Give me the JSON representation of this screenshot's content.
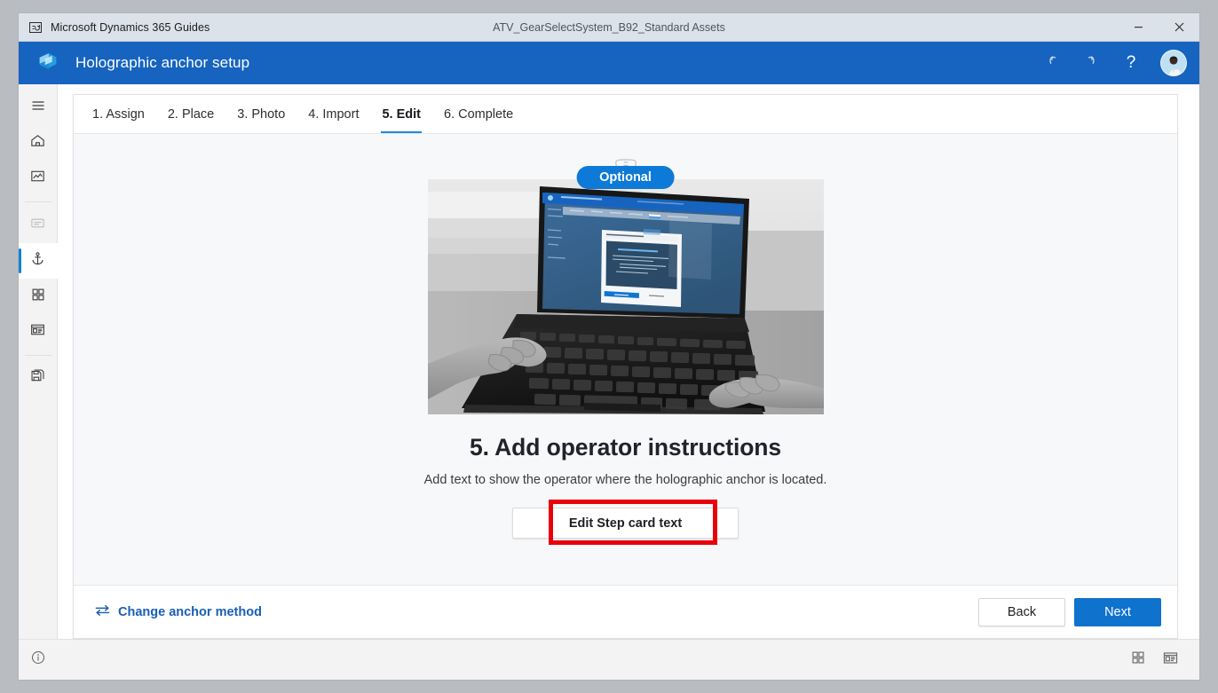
{
  "window": {
    "app_title": "Microsoft Dynamics 365 Guides",
    "document_title": "ATV_GearSelectSystem_B92_Standard Assets",
    "app_icon": "guides-app-icon",
    "controls": {
      "minimize": "minimize-icon",
      "close": "close-icon"
    }
  },
  "header": {
    "logo": "dynamics-guides-logo",
    "title": "Holographic anchor setup",
    "actions": [
      {
        "name": "undo-button",
        "icon": "undo-icon"
      },
      {
        "name": "redo-button",
        "icon": "redo-icon"
      },
      {
        "name": "help-button",
        "icon": "question-mark-icon",
        "label": "?"
      }
    ],
    "avatar": "user-avatar"
  },
  "sidebar": {
    "items": [
      {
        "name": "menu-toggle",
        "icon": "hamburger-menu-icon",
        "state": "default"
      },
      {
        "name": "home",
        "icon": "home-icon",
        "state": "default"
      },
      {
        "name": "analytics",
        "icon": "analytics-image-icon",
        "state": "default"
      },
      {
        "name": "outline",
        "icon": "document-lines-icon",
        "state": "disabled"
      },
      {
        "name": "anchor",
        "icon": "anchor-icon",
        "state": "selected"
      },
      {
        "name": "steps-grid",
        "icon": "grid-squares-icon",
        "state": "default"
      },
      {
        "name": "step-card",
        "icon": "step-card-icon",
        "state": "default"
      },
      {
        "name": "assets",
        "icon": "save-copy-icon",
        "state": "default"
      }
    ],
    "bottom": {
      "name": "info",
      "icon": "info-circle-icon"
    }
  },
  "tabs": [
    {
      "label": "1. Assign",
      "active": false
    },
    {
      "label": "2. Place",
      "active": false
    },
    {
      "label": "3. Photo",
      "active": false
    },
    {
      "label": "4. Import",
      "active": false
    },
    {
      "label": "5. Edit",
      "active": true
    },
    {
      "label": "6. Complete",
      "active": false
    }
  ],
  "main": {
    "headset_icon": "hololens-headset-icon",
    "optional_badge": "Optional",
    "illustration": "photo-hands-typing-on-laptop-with-edit-anchoring-instructions-dialog",
    "title": "5. Add operator instructions",
    "subtitle": "Add text to show the operator where the holographic anchor is located.",
    "edit_button": "Edit Step card text",
    "annotation": "red-highlight-box"
  },
  "footer": {
    "change_link": "Change anchor method",
    "change_icon": "swap-arrows-icon",
    "back_button": "Back",
    "next_button": "Next"
  },
  "statusbar": {
    "left_icon": "info-circle-icon",
    "right_icons": [
      {
        "name": "grid-view",
        "icon": "grid-view-icon"
      },
      {
        "name": "detail-view",
        "icon": "detail-view-icon"
      }
    ]
  },
  "colors": {
    "header_blue": "#1664c0",
    "accent_blue": "#0f72cd",
    "badge_blue": "#0d7ad8",
    "tab_underline": "#1a8ae0",
    "link_blue": "#1a5fb4",
    "annotation_red": "#e8000b",
    "titlebar": "#dbe2ea",
    "card_bg": "#f7f8fa"
  }
}
